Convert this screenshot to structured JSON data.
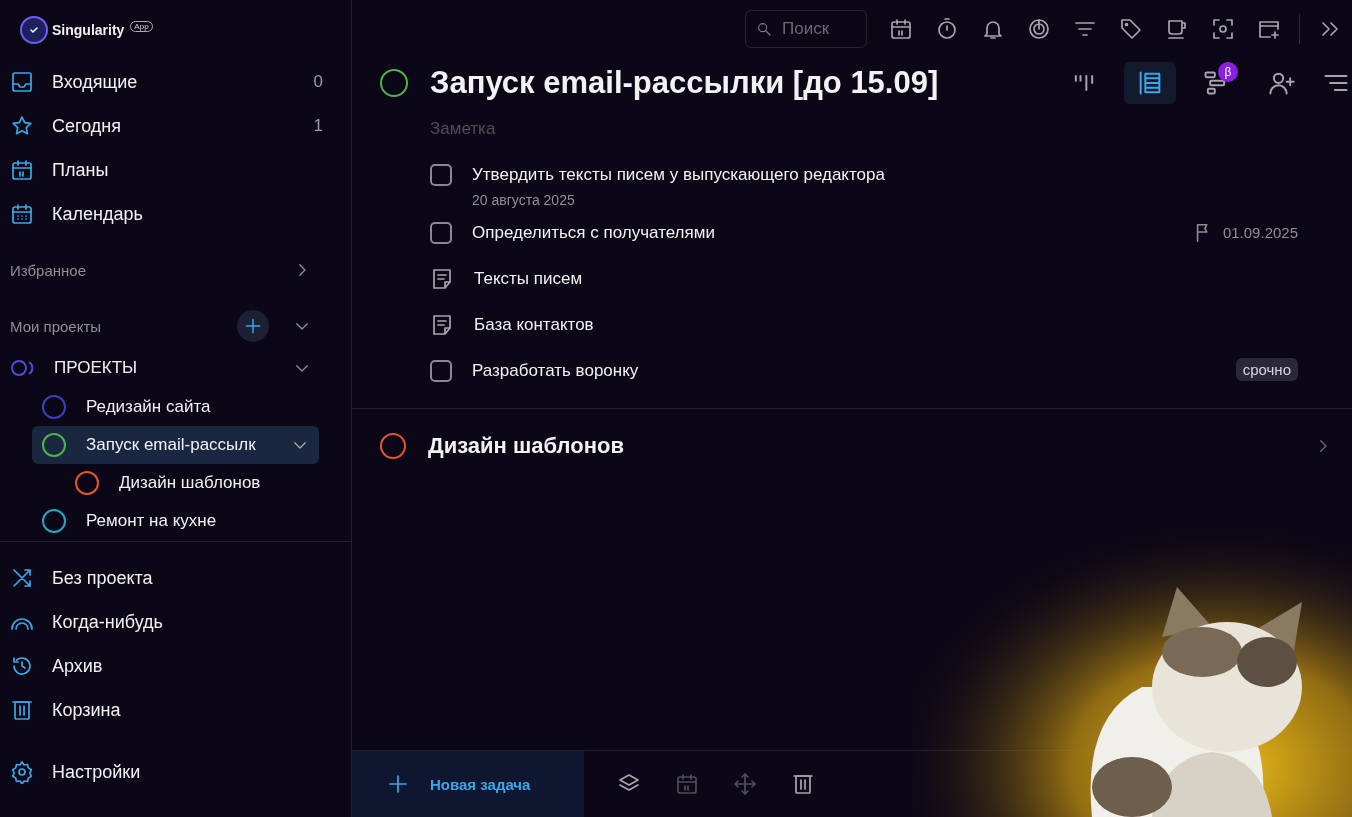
{
  "app": {
    "name": "Singularity",
    "badge": "App"
  },
  "nav": [
    {
      "kind": "inbox",
      "label": "Входящие",
      "count": "0"
    },
    {
      "kind": "today",
      "label": "Сегодня",
      "count": "1"
    },
    {
      "kind": "plans",
      "label": "Планы"
    },
    {
      "kind": "calendar",
      "label": "Календарь"
    }
  ],
  "favorites": {
    "label": "Избранное",
    "expanded": false
  },
  "projects": {
    "label": "Мои проекты",
    "expanded": true,
    "groups": [
      {
        "label": "ПРОЕКТЫ",
        "expanded": true,
        "children": [
          {
            "label": "Редизайн сайта",
            "color": "#3d3fb8",
            "selected": false
          },
          {
            "label": "Запуск email-рассылк",
            "color": "#4cb34a",
            "selected": true,
            "expanded": true,
            "children": [
              {
                "label": "Дизайн шаблонов",
                "color": "#e0572b",
                "selected": false
              }
            ]
          },
          {
            "label": "Ремонт на кухне",
            "color": "#1fa8c4",
            "selected": false
          }
        ]
      }
    ]
  },
  "bottom_nav": [
    {
      "kind": "no-project",
      "label": "Без проекта"
    },
    {
      "kind": "someday",
      "label": "Когда-нибудь"
    },
    {
      "kind": "archive",
      "label": "Архив"
    },
    {
      "kind": "trash",
      "label": "Корзина"
    }
  ],
  "settings": {
    "label": "Настройки"
  },
  "search": {
    "placeholder": "Поиск"
  },
  "project": {
    "title": "Запуск email-рассылки [до 15.09]",
    "color": "#4cb34a",
    "note_placeholder": "Заметка",
    "views": [
      {
        "kind": "board",
        "selected": false
      },
      {
        "kind": "list",
        "selected": true
      },
      {
        "kind": "gantt",
        "selected": false,
        "badge": "β"
      }
    ]
  },
  "tasks": [
    {
      "kind": "task",
      "title": "Утвердить тексты писем у выпускающего редактора",
      "checked": false,
      "date": "20 августа 2025"
    },
    {
      "kind": "task",
      "title": "Определиться с получателями",
      "checked": false,
      "deadline": "01.09.2025"
    },
    {
      "kind": "note",
      "title": "Тексты писем"
    },
    {
      "kind": "note",
      "title": "База контактов"
    },
    {
      "kind": "task",
      "title": "Разработать воронку",
      "checked": false,
      "tag": "срочно"
    }
  ],
  "subprojects": [
    {
      "title": "Дизайн шаблонов",
      "color": "#e0572b"
    }
  ],
  "footer": {
    "new_task": "Новая задача"
  }
}
